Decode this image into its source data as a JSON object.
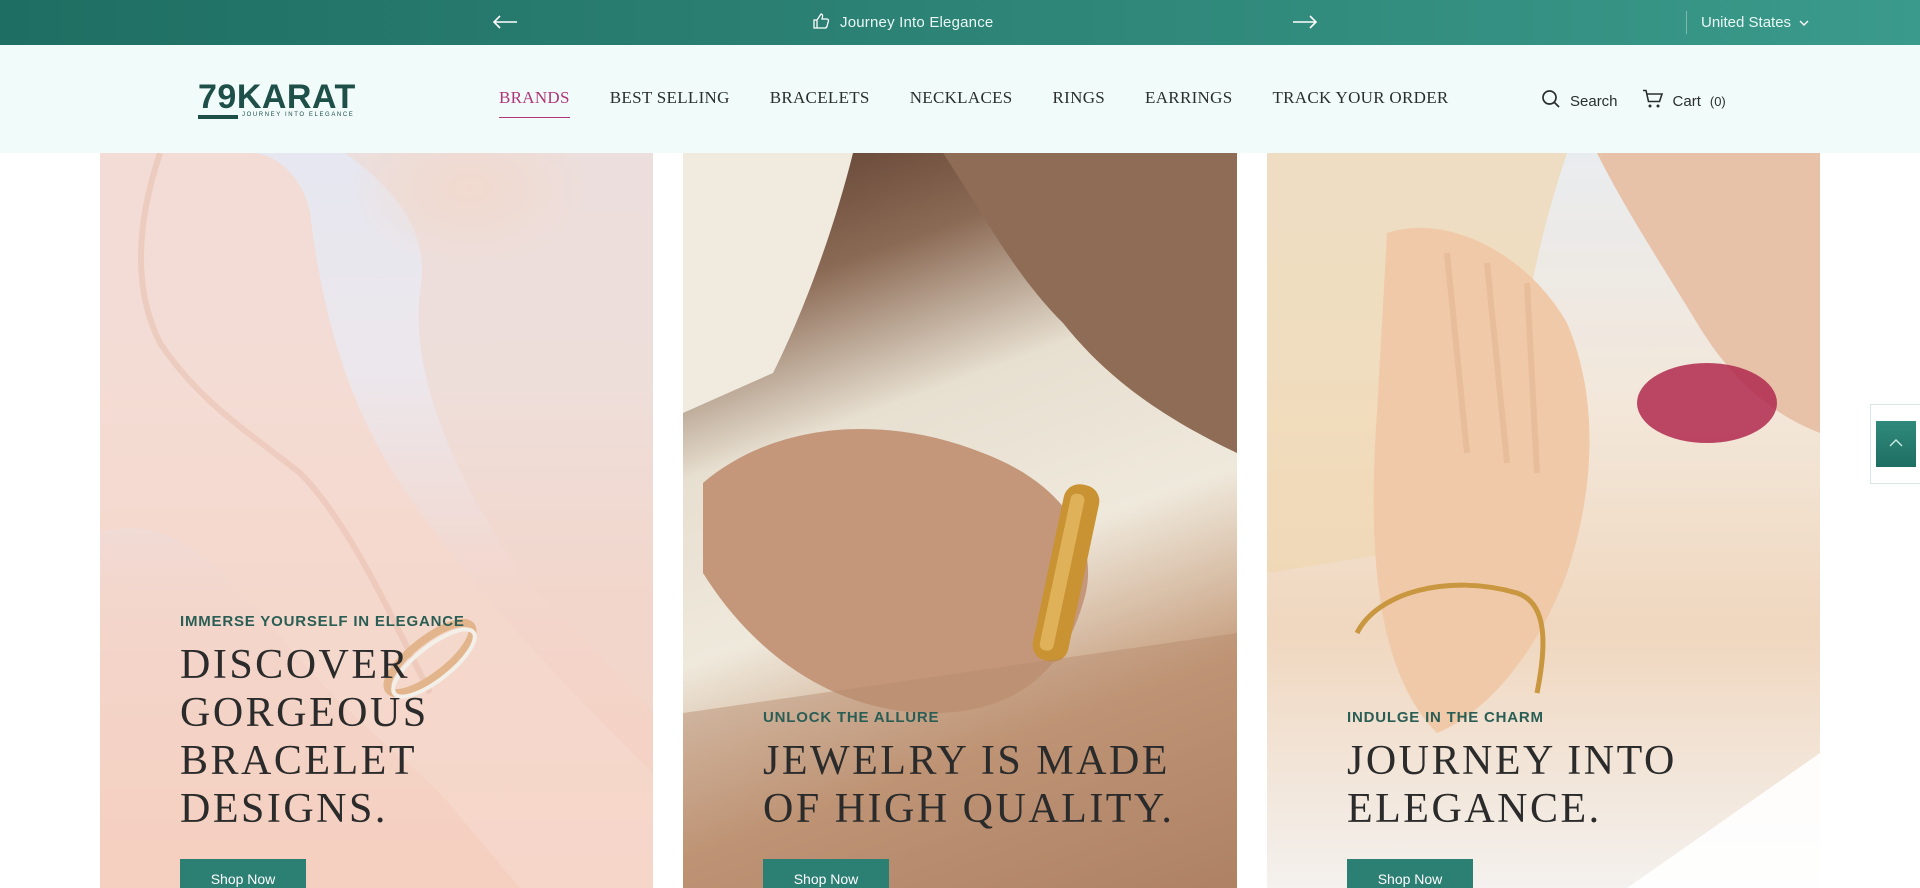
{
  "announcement": {
    "message": "Journey Into Elegance",
    "icon": "thumbs-up-icon",
    "prev_icon": "arrow-left-icon",
    "next_icon": "arrow-right-icon",
    "country": "United States"
  },
  "header": {
    "logo_text": "79KARAT",
    "logo_tagline": "JOURNEY INTO ELEGANCE",
    "nav": [
      {
        "label": "BRANDS",
        "active": true
      },
      {
        "label": "BEST SELLING"
      },
      {
        "label": "BRACELETS"
      },
      {
        "label": "NECKLACES"
      },
      {
        "label": "RINGS"
      },
      {
        "label": "EARRINGS"
      },
      {
        "label": "TRACK YOUR ORDER"
      }
    ],
    "search_label": "Search",
    "cart_label": "Cart",
    "cart_count": "(0)"
  },
  "hero": [
    {
      "kicker": "IMMERSE YOURSELF IN ELEGANCE",
      "headline": "DISCOVER GORGEOUS BRACELET DESIGNS.",
      "button": "Shop Now"
    },
    {
      "kicker": "UNLOCK THE ALLURE",
      "headline": "JEWELRY IS MADE OF HIGH QUALITY.",
      "button": "Shop Now"
    },
    {
      "kicker": "INDULGE IN THE CHARM",
      "headline": "JOURNEY INTO ELEGANCE.",
      "button": "Shop Now"
    }
  ],
  "colors": {
    "announcement_bg": "#2a7f72",
    "brand_dark": "#1e4f49",
    "active_nav": "#b0367a",
    "button_bg": "#2c7f73"
  }
}
